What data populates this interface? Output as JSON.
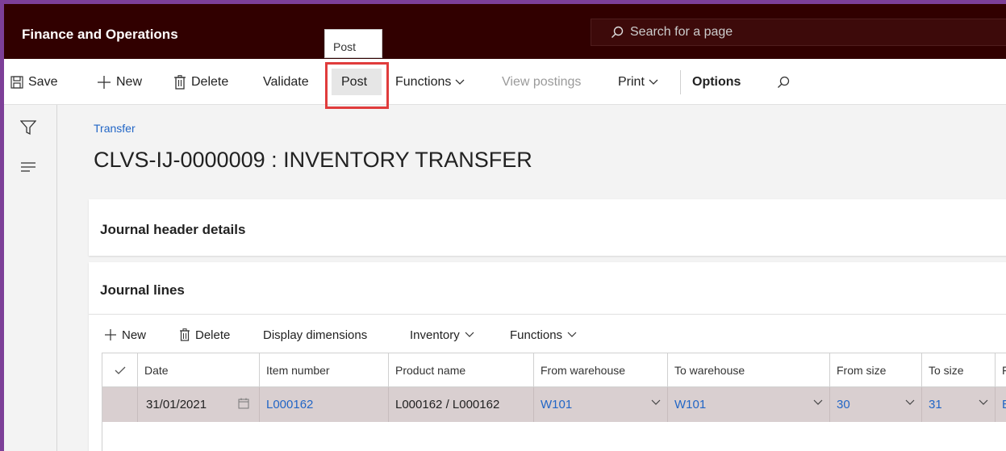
{
  "app": {
    "title": "Finance and Operations"
  },
  "search": {
    "placeholder": "Search for a page"
  },
  "tooltip": {
    "text": "Post"
  },
  "toolbar": {
    "save": "Save",
    "new": "New",
    "delete": "Delete",
    "validate": "Validate",
    "post": "Post",
    "functions": "Functions",
    "view_postings": "View postings",
    "print": "Print",
    "options": "Options"
  },
  "breadcrumb": "Transfer",
  "page_title": "CLVS-IJ-0000009 : INVENTORY TRANSFER",
  "sections": {
    "header_details": "Journal header details",
    "journal_lines": "Journal lines"
  },
  "lines_toolbar": {
    "new": "New",
    "delete": "Delete",
    "display_dimensions": "Display dimensions",
    "inventory": "Inventory",
    "functions": "Functions"
  },
  "grid": {
    "columns": [
      "Date",
      "Item number",
      "Product name",
      "From warehouse",
      "To warehouse",
      "From size",
      "To size",
      "F"
    ],
    "row": {
      "date": "31/01/2021",
      "item_number": "L000162",
      "product_name": "L000162 / L000162",
      "from_warehouse": "W101",
      "to_warehouse": "W101",
      "from_size": "30",
      "to_size": "31",
      "next": "B"
    }
  },
  "colors": {
    "topbar": "#310000",
    "accent_link": "#2266c6",
    "highlight": "#e03c3c",
    "selected_row": "#d9cfd0"
  }
}
